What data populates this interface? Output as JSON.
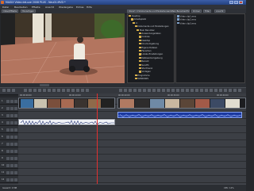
{
  "window": {
    "title": "MAGIX Video deLuxe 2008 PLUS - Neu01.MVD *",
    "controls": [
      "_",
      "□",
      "x"
    ]
  },
  "menu": [
    "Datei",
    "Bearbeiten",
    "Effekte",
    "Ansicht",
    "Wiedergabe",
    "Extras",
    "Hilfe"
  ],
  "toolbar": {
    "left_tab": "Video/Effekte",
    "right_tab": "Hinzufügen",
    "path": "C:\\Dokumente und Einstellungen\\Mein Benutzer\\Eigene Dateien\\...",
    "nav_buttons": [
      "Importieren",
      "Ordner",
      "Filter",
      "Ansicht"
    ]
  },
  "tree": [
    {
      "label": "Desktop",
      "depth": 0
    },
    {
      "label": "Arbeitsplatz",
      "depth": 1
    },
    {
      "label": "C:",
      "depth": 2
    },
    {
      "label": "Dokumente und Einstellungen",
      "depth": 3
    },
    {
      "label": "Mein Benutzer",
      "depth": 4
    },
    {
      "label": "Anwendungsdaten",
      "depth": 5
    },
    {
      "label": "Cookies",
      "depth": 5
    },
    {
      "label": "Desktop",
      "depth": 5
    },
    {
      "label": "Druckumgebung",
      "depth": 5
    },
    {
      "label": "Eigene Dateien",
      "depth": 5
    },
    {
      "label": "Favoriten",
      "depth": 5
    },
    {
      "label": "Lokale Einstellungen",
      "depth": 5
    },
    {
      "label": "Netzwerkumgebung",
      "depth": 5
    },
    {
      "label": "Recent",
      "depth": 5
    },
    {
      "label": "SendTo",
      "depth": 5
    },
    {
      "label": "Startmenü",
      "depth": 5
    },
    {
      "label": "Vorlagen",
      "depth": 5
    },
    {
      "label": "Programme",
      "depth": 3
    },
    {
      "label": "WINDOWS",
      "depth": 3
    }
  ],
  "files": [
    "Video clip1.mxv",
    "Video clip2.mxv",
    "Video clip3.mxv"
  ],
  "timeline": {
    "tracks": [
      "1",
      "2",
      "3",
      "4",
      "5",
      "6",
      "7",
      "8",
      "9",
      "10",
      "11",
      "12",
      "13"
    ],
    "ruler_marks": [
      "00:00:00:00",
      "00:00:10:00",
      "00:00:20:00",
      "00:00:30:00",
      "00:00:40:00"
    ]
  },
  "status": {
    "left": "Gesamt: 0 MB",
    "right": "CPU: 12%"
  },
  "colors": {
    "titlebar": "#2b4a8e",
    "audio_clip": "#1f3fa8",
    "playhead": "#e03030",
    "folder": "#d8b04a"
  }
}
